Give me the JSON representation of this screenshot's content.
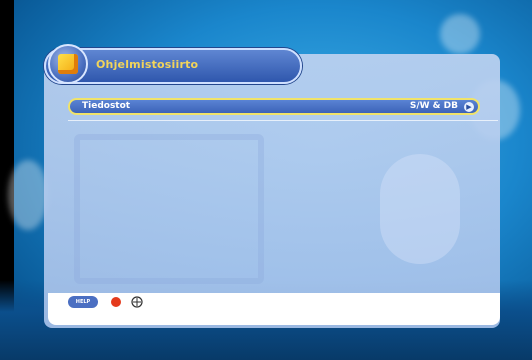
{
  "menu": {
    "title": "Ohjelmistosiirto",
    "icon": "software-folder-icon"
  },
  "rows": [
    {
      "label": "Tiedostot",
      "value": "S/W & DB",
      "icon": "arrow-right-icon"
    }
  ],
  "footer": {
    "help_label": "HELP",
    "red_button_icon": "red-button-icon",
    "nav_icon": "navigation-cross-icon"
  },
  "colors": {
    "title_text": "#f2d45a",
    "row_highlight_border": "#f0e36a",
    "red_button": "#e43a1c"
  }
}
